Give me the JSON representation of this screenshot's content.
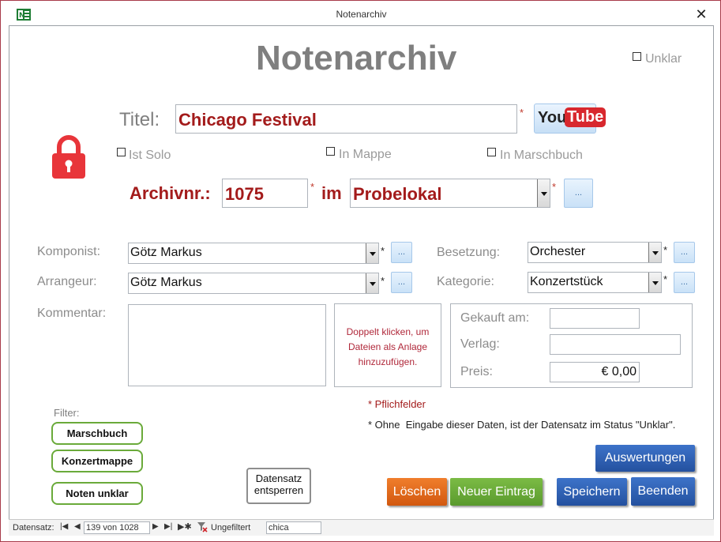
{
  "window": {
    "title": "Notenarchiv",
    "close_glyph": "✕"
  },
  "form": {
    "heading": "Notenarchiv",
    "unklar_label": "Unklar",
    "titel_label": "Titel:",
    "titel_value": "Chicago Festival",
    "youtube": {
      "you": "You",
      "tube": "Tube"
    },
    "ist_solo_label": "Ist Solo",
    "in_mappe_label": "In Mappe",
    "in_marschbuch_label": "In Marschbuch",
    "archivnr_label": "Archivnr.:",
    "archivnr_value": "1075",
    "im_label": "im",
    "ort_value": "Probelokal",
    "required_mark": "*",
    "ellipsis": "...",
    "komponist_label": "Komponist:",
    "komponist_value": "Götz Markus",
    "arrangeur_label": "Arrangeur:",
    "arrangeur_value": "Götz Markus",
    "besetzung_label": "Besetzung:",
    "besetzung_value": "Orchester",
    "kategorie_label": "Kategorie:",
    "kategorie_value": "Konzertstück",
    "kommentar_label": "Kommentar:",
    "kommentar_value": "",
    "attach_text": "Doppelt klicken, um Dateien als Anlage hinzuzufügen.",
    "gekauft_label": "Gekauft am:",
    "gekauft_value": "",
    "verlag_label": "Verlag:",
    "verlag_value": "",
    "preis_label": "Preis:",
    "preis_value": "€ 0,00",
    "pflicht_note": "* Pflichfelder",
    "status_note": "* Ohne  Eingabe dieser Daten, ist der Datensatz im Status \"Unklar\".",
    "filter_label": "Filter:",
    "filter_buttons": [
      "Marschbuch",
      "Konzertmappe",
      "Noten unklar"
    ],
    "unlock_button": [
      "Datensatz",
      "entsperren"
    ],
    "buttons": {
      "auswertungen": "Auswertungen",
      "loeschen": "Löschen",
      "neuer_eintrag": "Neuer Eintrag",
      "speichern": "Speichern",
      "beenden": "Beenden"
    }
  },
  "navbar": {
    "label": "Datensatz:",
    "position": "139 von 1028",
    "filter_status": "Ungefiltert",
    "search_value": "chica"
  },
  "colors": {
    "accent_red": "#a31b1b",
    "lock_red": "#e8353a",
    "green_border": "#6aaa3a",
    "blue_button": "#2e5fb6",
    "orange_button": "#e86a1c",
    "green_button": "#6aaa3a"
  }
}
